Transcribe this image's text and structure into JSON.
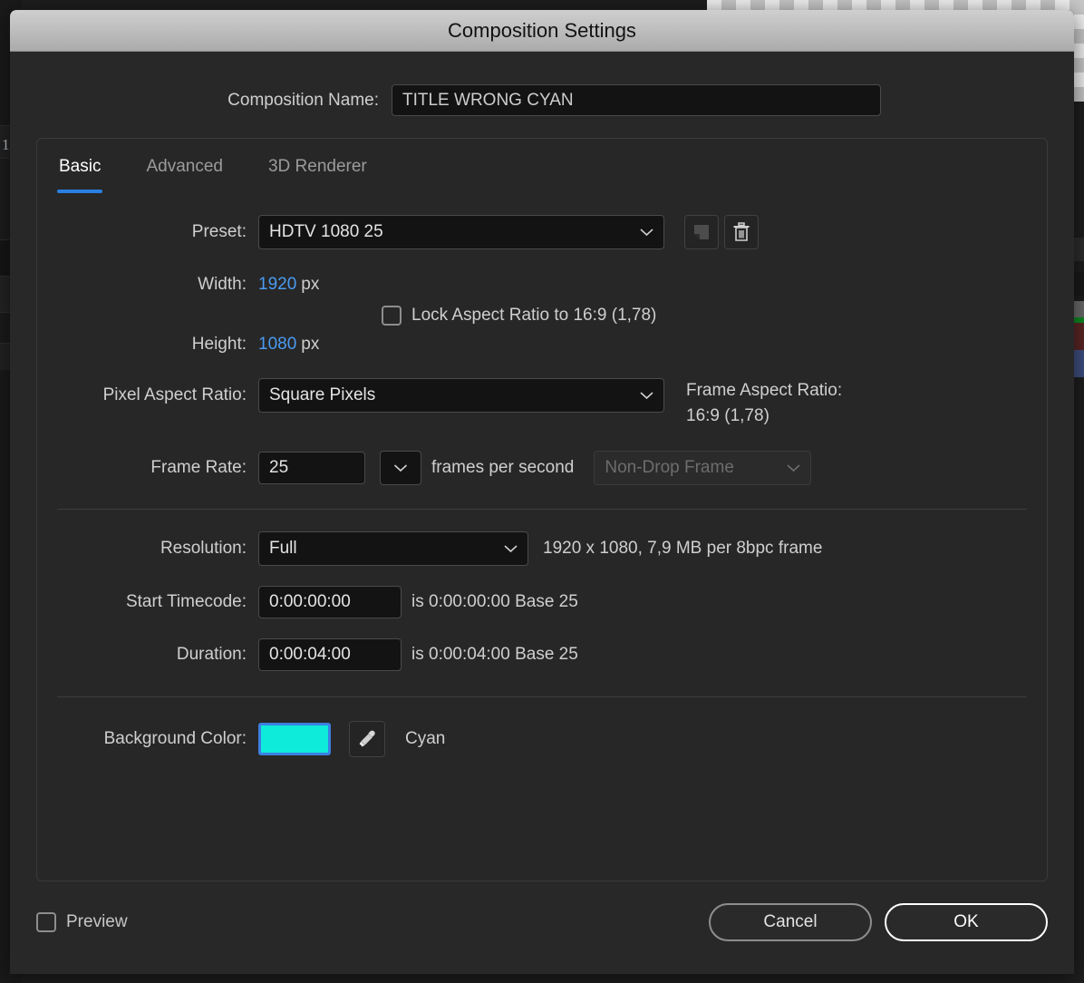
{
  "window": {
    "title": "Composition Settings"
  },
  "backdrop": {
    "layer_number": "1"
  },
  "composition_name": {
    "label": "Composition Name:",
    "value": "TITLE WRONG CYAN"
  },
  "tabs": [
    {
      "label": "Basic",
      "active": true
    },
    {
      "label": "Advanced",
      "active": false
    },
    {
      "label": "3D Renderer",
      "active": false
    }
  ],
  "basic": {
    "preset": {
      "label": "Preset:",
      "value": "HDTV 1080 25",
      "save_icon": "save-preset-icon",
      "delete_icon": "trash-icon"
    },
    "width": {
      "label": "Width:",
      "value": "1920",
      "unit": "px"
    },
    "height": {
      "label": "Height:",
      "value": "1080",
      "unit": "px"
    },
    "lock_aspect": {
      "label": "Lock Aspect Ratio to 16:9 (1,78)",
      "checked": false
    },
    "pixel_aspect_ratio": {
      "label": "Pixel Aspect Ratio:",
      "value": "Square Pixels"
    },
    "frame_aspect_ratio": {
      "label": "Frame Aspect Ratio:",
      "value": "16:9 (1,78)"
    },
    "frame_rate": {
      "label": "Frame Rate:",
      "value": "25",
      "unit": "frames per second",
      "drop_frame": "Non-Drop Frame",
      "drop_frame_disabled": true
    },
    "resolution": {
      "label": "Resolution:",
      "value": "Full",
      "info": "1920 x 1080, 7,9 MB per 8bpc frame"
    },
    "start_timecode": {
      "label": "Start Timecode:",
      "value": "0:00:00:00",
      "info": "is 0:00:00:00  Base 25"
    },
    "duration": {
      "label": "Duration:",
      "value": "0:00:04:00",
      "info": "is 0:00:04:00  Base 25"
    },
    "background_color": {
      "label": "Background Color:",
      "hex": "#0FEBDB",
      "name": "Cyan",
      "eyedropper_icon": "eyedropper-icon"
    }
  },
  "footer": {
    "preview": {
      "label": "Preview",
      "checked": false
    },
    "cancel_label": "Cancel",
    "ok_label": "OK"
  },
  "colors": {
    "accent_blue": "#2A7EE0",
    "value_blue": "#4A9BF0",
    "focus_ring": "#3C7FE0",
    "swatch_cyan": "#0FEBDB"
  }
}
